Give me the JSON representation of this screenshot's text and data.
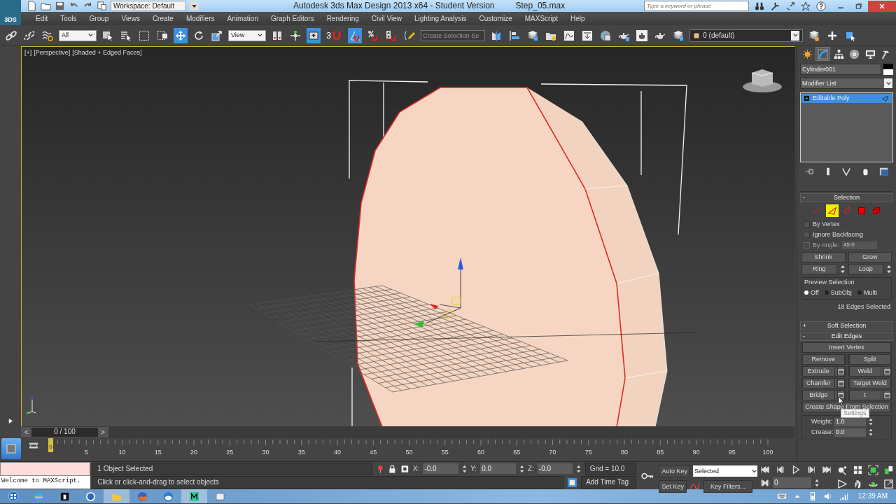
{
  "title_bar": {
    "app_label": "3DS",
    "workspace": "Workspace: Default",
    "title": "Autodesk 3ds Max Design 2013 x64  - Student Version",
    "file": "Step_05.max",
    "search": {
      "placeholder": "Type a keyword or phrase"
    }
  },
  "menu": [
    "Edit",
    "Tools",
    "Group",
    "Views",
    "Create",
    "Modifiers",
    "Animation",
    "Graph Editors",
    "Rendering",
    "Civil View",
    "Lighting Analysis",
    "Customize",
    "MAXScript",
    "Help"
  ],
  "toolbar": [
    {
      "kind": "link",
      "selected": false
    },
    {
      "kind": "unlink",
      "selected": false
    },
    {
      "kind": "bind",
      "selected": false
    },
    {
      "kind": "dropdown",
      "value": "All"
    },
    {
      "kind": "select",
      "selected": false
    },
    {
      "kind": "select-by-name",
      "selected": false
    },
    {
      "kind": "region",
      "selected": false
    },
    {
      "kind": "window",
      "selected": false
    },
    {
      "kind": "move",
      "selected": true
    },
    {
      "kind": "rotate",
      "selected": false
    },
    {
      "kind": "scale",
      "selected": false
    },
    {
      "kind": "dropdown",
      "value": "View"
    },
    {
      "kind": "pivot",
      "selected": false
    },
    {
      "kind": "manipulate",
      "selected": false
    },
    {
      "kind": "keyboard",
      "selected": true
    },
    {
      "kind": "snap",
      "label": "3",
      "selected": false
    },
    {
      "kind": "angle-snap",
      "selected": true
    },
    {
      "kind": "percent-snap",
      "selected": false
    },
    {
      "kind": "spinner-snap",
      "selected": false
    },
    {
      "kind": "named-selection",
      "selected": false
    },
    {
      "kind": "field",
      "placeholder": "Create Selection Se"
    },
    {
      "kind": "mirror",
      "selected": false
    },
    {
      "kind": "align",
      "selected": false
    },
    {
      "kind": "layers",
      "selected": false
    },
    {
      "kind": "scene-explorer",
      "selected": false
    },
    {
      "kind": "curve-editor",
      "selected": false
    },
    {
      "kind": "schematic",
      "selected": false
    },
    {
      "kind": "material",
      "selected": false
    },
    {
      "kind": "render-setup",
      "selected": false
    },
    {
      "kind": "render-frame",
      "selected": false
    },
    {
      "kind": "render",
      "selected": false
    },
    {
      "kind": "layers",
      "selected": false
    },
    {
      "kind": "layer-dropdown",
      "value": "0 (default)"
    },
    {
      "kind": "new-layer",
      "selected": false
    },
    {
      "kind": "add",
      "selected": false
    },
    {
      "kind": "select-layer",
      "selected": false
    }
  ],
  "viewport": {
    "labels": [
      "[+]",
      "[Perspective]",
      "[Shaded + Edged Faces]"
    ],
    "active": true
  },
  "command_panel": {
    "tabs": [
      {
        "kind": "create",
        "selected": false
      },
      {
        "kind": "modify",
        "selected": true
      },
      {
        "kind": "hierarchy",
        "selected": false
      },
      {
        "kind": "motion",
        "selected": false
      },
      {
        "kind": "display",
        "selected": false
      },
      {
        "kind": "utilities",
        "selected": false
      }
    ],
    "object_name": "Cylinder001",
    "modifier_list": "Modifier List",
    "stack": [
      {
        "label": "Editable Poly",
        "selected": true
      }
    ],
    "selection": {
      "toggle": "-",
      "title": "Selection",
      "levels": [
        {
          "kind": "vertex",
          "selected": false
        },
        {
          "kind": "edge",
          "selected": true
        },
        {
          "kind": "border",
          "selected": false
        },
        {
          "kind": "polygon",
          "selected": false
        },
        {
          "kind": "element",
          "selected": false
        }
      ],
      "options": [
        {
          "label": "By Vertex",
          "checked": false,
          "disabled": false
        },
        {
          "label": "Ignore Backfacing",
          "checked": false,
          "disabled": false
        },
        {
          "label": "By Angle:",
          "checked": false,
          "disabled": true,
          "value": "45.0"
        }
      ],
      "buttons": [
        {
          "label": "Shrink",
          "spinner": false
        },
        {
          "label": "Grow",
          "spinner": false
        },
        {
          "label": "Ring",
          "spinner": true
        },
        {
          "label": "Loop",
          "spinner": true
        }
      ],
      "preview": {
        "title": "Preview Selection",
        "options": [
          {
            "label": "Off",
            "selected": true
          },
          {
            "label": "SubObj",
            "selected": false
          },
          {
            "label": "Multi",
            "selected": false
          }
        ]
      },
      "status": "18 Edges Selected"
    },
    "soft_selection": {
      "toggle": "+",
      "title": "Soft Selection"
    },
    "edit_edges": {
      "toggle": "-",
      "title": "Edit Edges",
      "rows": [
        [
          {
            "label": "Insert Vertex",
            "settings": false
          }
        ],
        [
          {
            "label": "Remove",
            "settings": false
          },
          {
            "label": "Split",
            "settings": false
          }
        ],
        [
          {
            "label": "Extrude",
            "settings": true
          },
          {
            "label": "Weld",
            "settings": true
          }
        ],
        [
          {
            "label": "Chamfer",
            "settings": true
          },
          {
            "label": "Target Weld",
            "settings": false
          }
        ],
        [
          {
            "label": "Bridge",
            "settings": true
          },
          {
            "label": "t",
            "settings": true
          }
        ],
        [
          {
            "label": "Create Shape From Selection",
            "settings": false
          }
        ]
      ],
      "tooltip": "Settings",
      "fields": [
        {
          "label": "Weight:",
          "value": "1.0"
        },
        {
          "label": "Crease:",
          "value": "0.0"
        }
      ]
    }
  },
  "timeline": {
    "frame": "0 / 100",
    "prev": "<",
    "next": ">",
    "level": 0,
    "current_frame": "0",
    "ticks": [
      "5",
      "10",
      "15",
      "20",
      "25",
      "30",
      "35",
      "40",
      "45",
      "50",
      "55",
      "60",
      "65",
      "70",
      "75",
      "80",
      "85",
      "90",
      "95",
      "100"
    ]
  },
  "status_bar": {
    "listener_output": "Welcome to MAXScript.",
    "selection_status": "1 Object Selected",
    "prompt": "Click or click-and-drag to select objects",
    "coords": [
      {
        "axis": "X:",
        "value": "-0.0"
      },
      {
        "axis": "Y:",
        "value": "0.0"
      },
      {
        "axis": "Z:",
        "value": "-0.0"
      }
    ],
    "grid": "Grid = 10.0",
    "time_tag": "Add Time Tag",
    "auto_key": {
      "label": "Auto Key",
      "on": false
    },
    "set_key": "Set Key",
    "key_mode": "Selected",
    "key_filters": "Key Filters...",
    "frame": "0"
  },
  "taskbar": {
    "apps": [
      {
        "kind": "browser",
        "active": false
      },
      {
        "kind": "hand",
        "active": false
      },
      {
        "kind": "hp",
        "active": false
      },
      {
        "kind": "folder",
        "active": true
      },
      {
        "kind": "fox",
        "active": false
      },
      {
        "kind": "mail",
        "active": false
      },
      {
        "kind": "max",
        "active": true
      },
      {
        "kind": "window",
        "active": false
      }
    ],
    "clock": "12:39 AM"
  }
}
